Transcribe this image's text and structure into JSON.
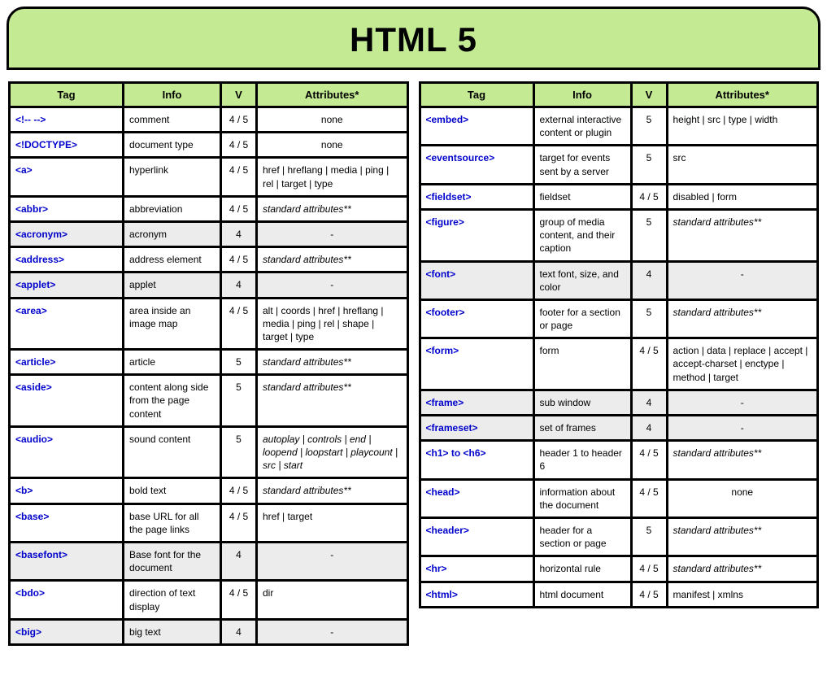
{
  "title": "HTML 5",
  "headers": {
    "tag": "Tag",
    "info": "Info",
    "v": "V",
    "attrs": "Attributes*"
  },
  "left_rows": [
    {
      "tag": "<!-- -->",
      "info": "comment",
      "v": "4 / 5",
      "attrs": "none",
      "dep": false,
      "center": true
    },
    {
      "tag": "<!DOCTYPE>",
      "info": "document type",
      "v": "4 / 5",
      "attrs": "none",
      "dep": false,
      "center": true
    },
    {
      "tag": "<a>",
      "info": "hyperlink",
      "v": "4 / 5",
      "attrs": "href | hreflang | media | ping | rel | target | type",
      "dep": false
    },
    {
      "tag": "<abbr>",
      "info": "abbreviation",
      "v": "4 / 5",
      "attrs": "standard attributes**",
      "dep": false,
      "italic": true
    },
    {
      "tag": "<acronym>",
      "info": "acronym",
      "v": "4",
      "attrs": "-",
      "dep": true
    },
    {
      "tag": "<address>",
      "info": "address element",
      "v": "4 / 5",
      "attrs": "standard attributes**",
      "dep": false,
      "italic": true
    },
    {
      "tag": "<applet>",
      "info": "applet",
      "v": "4",
      "attrs": "-",
      "dep": true
    },
    {
      "tag": "<area>",
      "info": "area inside an image map",
      "v": "4 / 5",
      "attrs": "alt | coords | href | hreflang | media | ping | rel | shape | target | type",
      "dep": false
    },
    {
      "tag": "<article>",
      "info": "article",
      "v": "5",
      "attrs": "standard attributes**",
      "dep": false,
      "italic": true
    },
    {
      "tag": "<aside>",
      "info": "content along side from the page content",
      "v": "5",
      "attrs": "standard attributes**",
      "dep": false,
      "italic": true
    },
    {
      "tag": "<audio>",
      "info": "sound content",
      "v": "5",
      "attrs": "autoplay | controls | end | loopend | loopstart | playcount | src | start",
      "dep": false,
      "italic": true
    },
    {
      "tag": "<b>",
      "info": "bold text",
      "v": "4 / 5",
      "attrs": "standard attributes**",
      "dep": false,
      "italic": true
    },
    {
      "tag": "<base>",
      "info": "base URL for all the page links",
      "v": "4 / 5",
      "attrs": "href | target",
      "dep": false
    },
    {
      "tag": "<basefont>",
      "info": "Base font for the document",
      "v": "4",
      "attrs": "-",
      "dep": true
    },
    {
      "tag": "<bdo>",
      "info": "direction of text display",
      "v": "4 / 5",
      "attrs": "dir",
      "dep": false
    },
    {
      "tag": "<big>",
      "info": "big text",
      "v": "4",
      "attrs": "-",
      "dep": true
    }
  ],
  "right_rows": [
    {
      "tag": "<embed>",
      "info": "external interactive content or plugin",
      "v": "5",
      "attrs": "height | src | type | width",
      "dep": false
    },
    {
      "tag": "<eventsource>",
      "info": "target for events sent by a server",
      "v": "5",
      "attrs": "src",
      "dep": false
    },
    {
      "tag": "<fieldset>",
      "info": "fieldset",
      "v": "4 / 5",
      "attrs": "disabled | form",
      "dep": false
    },
    {
      "tag": "<figure>",
      "info": "group of media content, and their caption",
      "v": "5",
      "attrs": "standard attributes**",
      "dep": false,
      "italic": true
    },
    {
      "tag": "<font>",
      "info": "text font, size, and color",
      "v": "4",
      "attrs": "-",
      "dep": true
    },
    {
      "tag": "<footer>",
      "info": "footer for a section or page",
      "v": "5",
      "attrs": "standard attributes**",
      "dep": false,
      "italic": true
    },
    {
      "tag": "<form>",
      "info": "form",
      "v": "4 / 5",
      "attrs": "action | data | replace | accept | accept-charset | enctype | method | target",
      "dep": false
    },
    {
      "tag": "<frame>",
      "info": "sub window",
      "v": "4",
      "attrs": "-",
      "dep": true
    },
    {
      "tag": "<frameset>",
      "info": "set of frames",
      "v": "4",
      "attrs": "-",
      "dep": true
    },
    {
      "tag": "<h1> to <h6>",
      "info": "header 1 to header 6",
      "v": "4 / 5",
      "attrs": "standard attributes**",
      "dep": false,
      "italic": true
    },
    {
      "tag": "<head>",
      "info": "information about the document",
      "v": "4 / 5",
      "attrs": "none",
      "dep": false,
      "center": true
    },
    {
      "tag": "<header>",
      "info": "header for a section or page",
      "v": "5",
      "attrs": "standard attributes**",
      "dep": false,
      "italic": true
    },
    {
      "tag": "<hr>",
      "info": "horizontal rule",
      "v": "4 / 5",
      "attrs": "standard attributes**",
      "dep": false,
      "italic": true
    },
    {
      "tag": "<html>",
      "info": "html document",
      "v": "4 / 5",
      "attrs": "manifest | xmlns",
      "dep": false
    }
  ]
}
